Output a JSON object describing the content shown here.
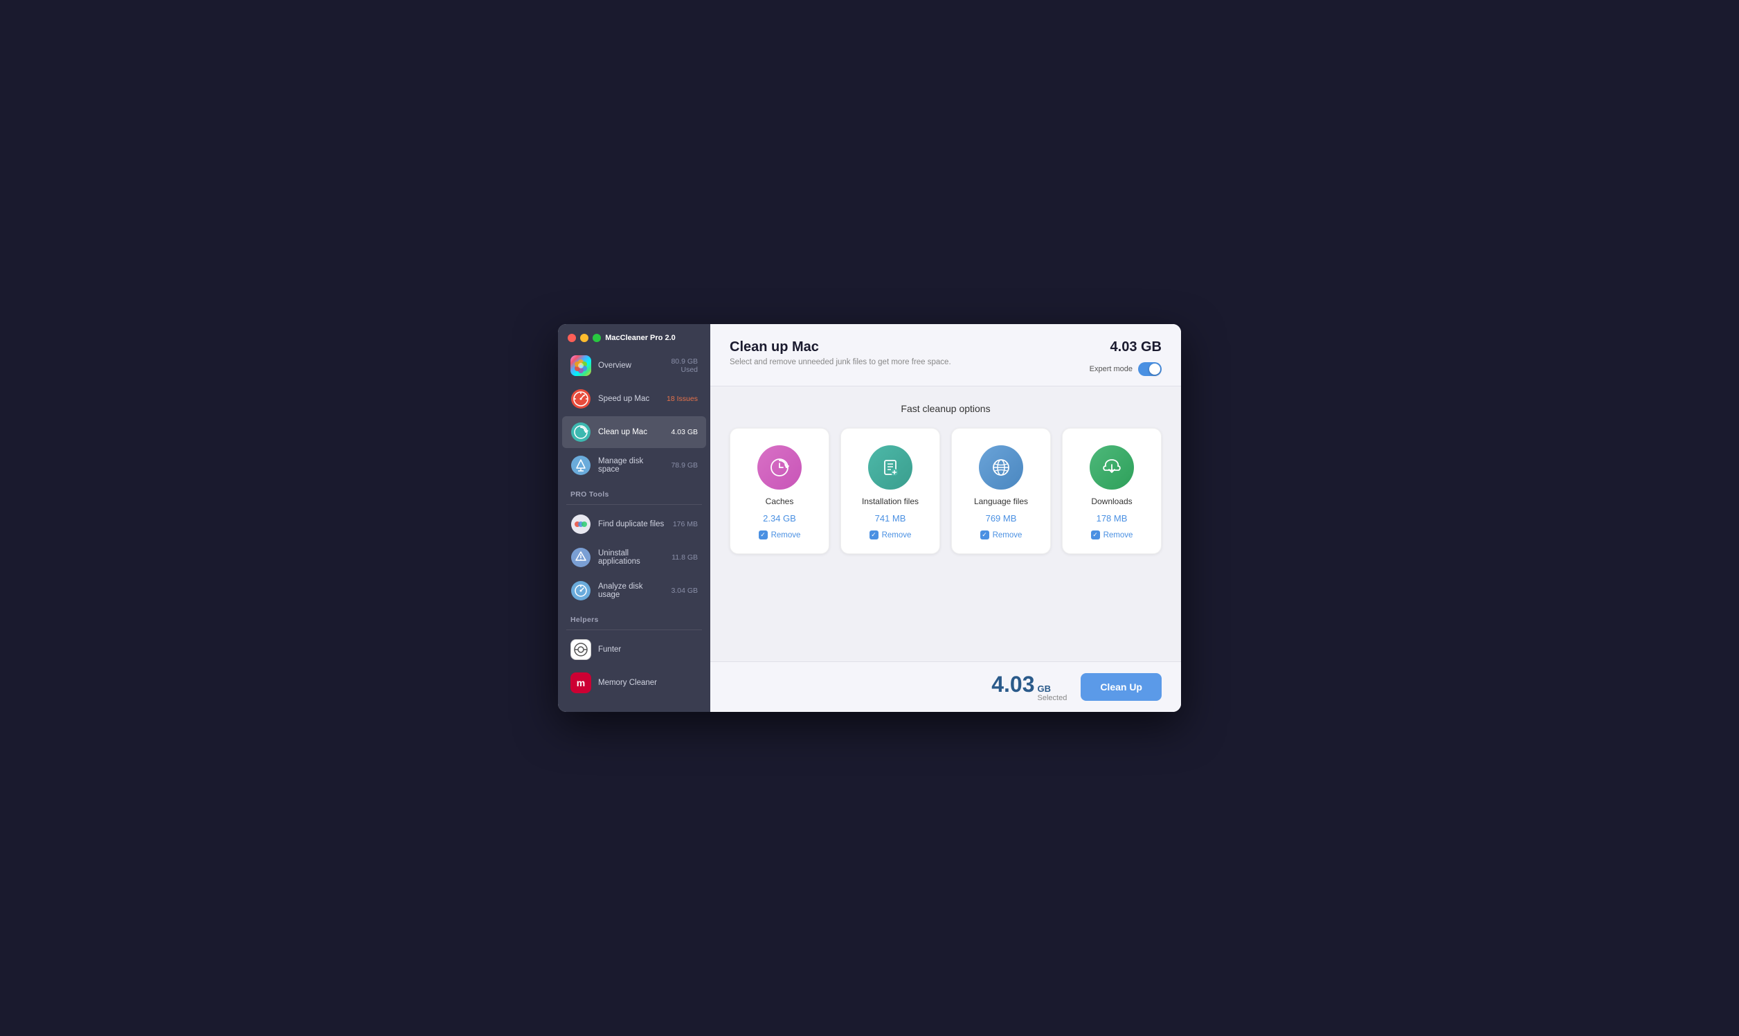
{
  "app": {
    "title": "MacCleaner Pro 2.0"
  },
  "sidebar": {
    "sections": [
      {
        "items": [
          {
            "id": "overview",
            "label": "Overview",
            "badge": "80.9 GB\nUsed",
            "badge_line1": "80.9 GB",
            "badge_line2": "Used",
            "icon": "overview"
          },
          {
            "id": "speedup",
            "label": "Speed up Mac",
            "badge": "18 Issues",
            "icon": "speedup",
            "badge_type": "issues"
          },
          {
            "id": "cleanup",
            "label": "Clean up Mac",
            "badge": "4.03 GB",
            "icon": "cleanup",
            "active": true
          },
          {
            "id": "disk",
            "label": "Manage disk space",
            "badge": "78.9 GB",
            "icon": "disk"
          }
        ]
      },
      {
        "header": "PRO Tools",
        "items": [
          {
            "id": "duplicate",
            "label": "Find duplicate files",
            "badge": "176 MB",
            "icon": "duplicate"
          },
          {
            "id": "uninstall",
            "label": "Uninstall applications",
            "badge": "11.8 GB",
            "icon": "uninstall"
          },
          {
            "id": "analyze",
            "label": "Analyze disk usage",
            "badge": "3.04 GB",
            "icon": "analyze"
          }
        ]
      },
      {
        "header": "Helpers",
        "items": [
          {
            "id": "funter",
            "label": "Funter",
            "badge": "",
            "icon": "funter"
          },
          {
            "id": "memory",
            "label": "Memory Cleaner",
            "badge": "",
            "icon": "memory"
          }
        ]
      }
    ]
  },
  "main": {
    "title": "Clean up Mac",
    "subtitle": "Select and remove unneeded junk files to get more free space.",
    "total_size": "4.03 GB",
    "expert_mode_label": "Expert mode",
    "section_title": "Fast cleanup options",
    "cards": [
      {
        "id": "caches",
        "name": "Caches",
        "size": "2.34 GB",
        "remove_label": "Remove",
        "icon_type": "caches"
      },
      {
        "id": "installation",
        "name": "Installation files",
        "size": "741 MB",
        "remove_label": "Remove",
        "icon_type": "installation"
      },
      {
        "id": "language",
        "name": "Language files",
        "size": "769 MB",
        "remove_label": "Remove",
        "icon_type": "language"
      },
      {
        "id": "downloads",
        "name": "Downloads",
        "size": "178 MB",
        "remove_label": "Remove",
        "icon_type": "downloads"
      }
    ],
    "footer": {
      "size_num": "4.03",
      "size_unit": "GB",
      "size_label": "Selected",
      "cleanup_btn": "Clean Up"
    }
  },
  "colors": {
    "accent": "#4a90e2",
    "sidebar_bg": "#3a3d50",
    "main_bg": "#f0f0f5"
  }
}
